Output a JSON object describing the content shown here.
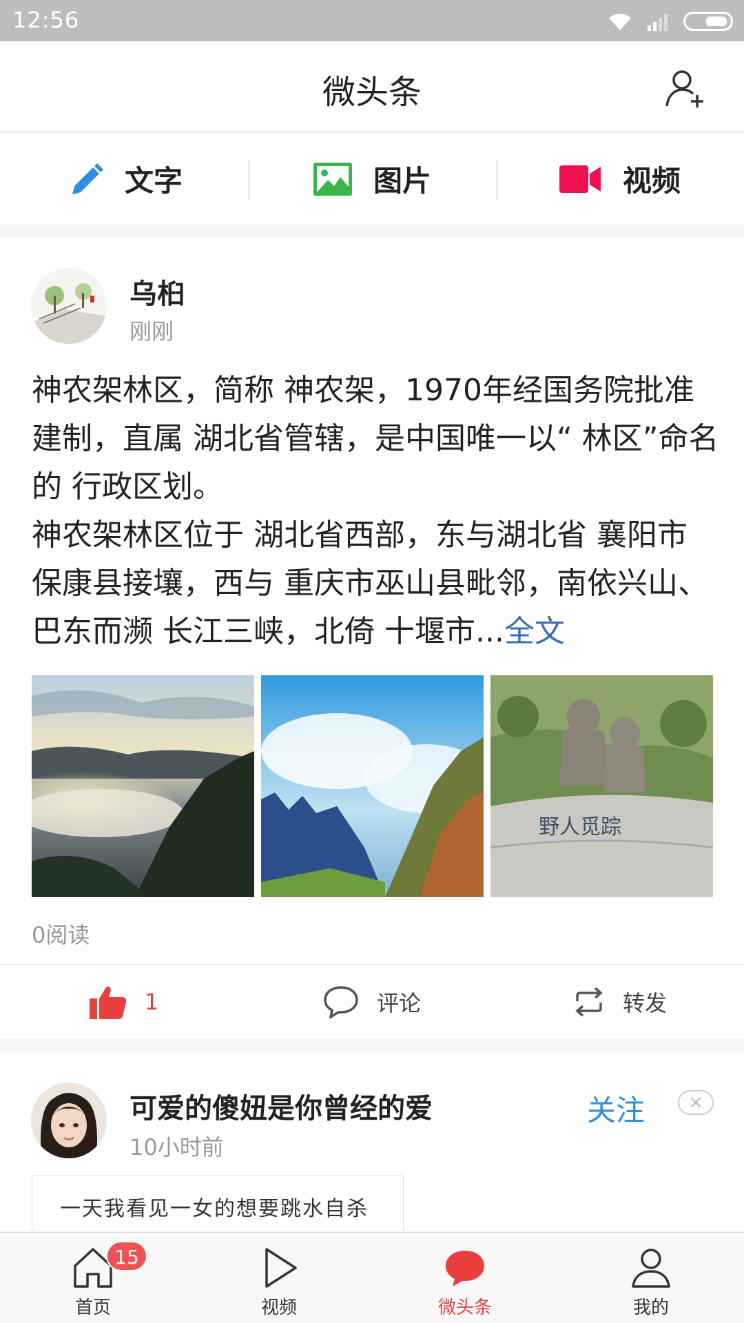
{
  "status_bar": {
    "time": "12:56"
  },
  "header": {
    "title": "微头条"
  },
  "post_types": [
    {
      "label": "文字",
      "icon": "pencil-icon",
      "color": "#2e8ee0"
    },
    {
      "label": "图片",
      "icon": "image-icon",
      "color": "#3bb54a"
    },
    {
      "label": "视频",
      "icon": "video-icon",
      "color": "#f0104f"
    }
  ],
  "post1": {
    "author": "乌桕",
    "time": "刚刚",
    "content": "神农架林区，简称 神农架，1970年经国务院批准建制，直属 湖北省管辖，是中国唯一以“ 林区”命名的 行政区划。\n神农架林区位于 湖北省西部，东与湖北省 襄阳市 保康县接壤，西与 重庆市巫山县毗邻，南依兴山、巴东而濒 长江三峡，北倚 十堰市...",
    "more_link": "全文",
    "images": [
      "cloud-sea-mountain-photo",
      "blue-peaks-photo",
      "wildman-statue-photo"
    ],
    "statue_inscription": "野人觅踪",
    "reads": "0阅读",
    "like_count": "1",
    "comment_label": "评论",
    "share_label": "转发"
  },
  "post2": {
    "author": "可爱的傻妞是你曾经的爱",
    "time": "10小时前",
    "follow_label": "关注",
    "dismiss_label": "×",
    "thumb_text": "一天我看见一女的想要跳水自杀"
  },
  "tabbar": {
    "items": [
      {
        "label": "首页",
        "icon": "home-icon",
        "badge": "15"
      },
      {
        "label": "视频",
        "icon": "play-icon"
      },
      {
        "label": "微头条",
        "icon": "chat-bubble-icon",
        "active": true
      },
      {
        "label": "我的",
        "icon": "person-icon"
      }
    ]
  },
  "colors": {
    "accent_red": "#e9403e",
    "link_blue": "#3a6db0",
    "follow_blue": "#2e8ee0"
  }
}
